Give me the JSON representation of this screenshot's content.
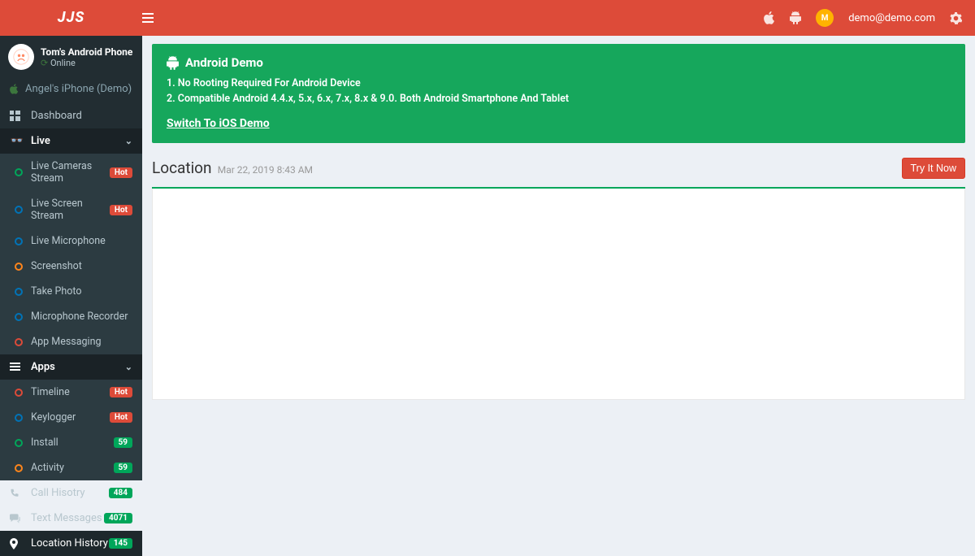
{
  "brand": "JJS",
  "header": {
    "user_email": "demo@demo.com"
  },
  "user_panel": {
    "name": "Tom's Android Phone",
    "status": "Online"
  },
  "alt_device": "Angel's iPhone (Demo)",
  "dashboard_label": "Dashboard",
  "sections": {
    "live": {
      "title": "Live",
      "items": [
        {
          "label": "Live Cameras Stream",
          "badge": "Hot",
          "ring": "green"
        },
        {
          "label": "Live Screen Stream",
          "badge": "Hot",
          "ring": "blue"
        },
        {
          "label": "Live Microphone",
          "badge": "",
          "ring": "blue"
        },
        {
          "label": "Screenshot",
          "badge": "",
          "ring": "orange"
        },
        {
          "label": "Take Photo",
          "badge": "",
          "ring": "blue"
        },
        {
          "label": "Microphone Recorder",
          "badge": "",
          "ring": "blue"
        },
        {
          "label": "App Messaging",
          "badge": "",
          "ring": "red"
        }
      ]
    },
    "apps": {
      "title": "Apps",
      "items": [
        {
          "label": "Timeline",
          "badge": "Hot",
          "ring": "red"
        },
        {
          "label": "Keylogger",
          "badge": "Hot",
          "ring": "blue"
        },
        {
          "label": "Install",
          "badge": "59",
          "ring": "green"
        },
        {
          "label": "Activity",
          "badge": "59",
          "ring": "orange"
        }
      ]
    }
  },
  "flat_items": [
    {
      "label": "Call Hisotry",
      "badge": "484",
      "icon": "phone"
    },
    {
      "label": "Text Messages",
      "badge": "4071",
      "icon": "chat"
    },
    {
      "label": "Location History",
      "badge": "145",
      "icon": "pin",
      "active": true
    }
  ],
  "banner": {
    "title": "Android Demo",
    "line1": "1. No Rooting Required For Android Device",
    "line2": "2. Compatible Android 4.4.x, 5.x, 6.x, 7.x, 8.x & 9.0. Both Android Smartphone And Tablet",
    "link": "Switch To iOS Demo"
  },
  "page": {
    "title": "Location",
    "subtitle": "Mar 22, 2019 8:43 AM",
    "try_btn": "Try It Now"
  }
}
